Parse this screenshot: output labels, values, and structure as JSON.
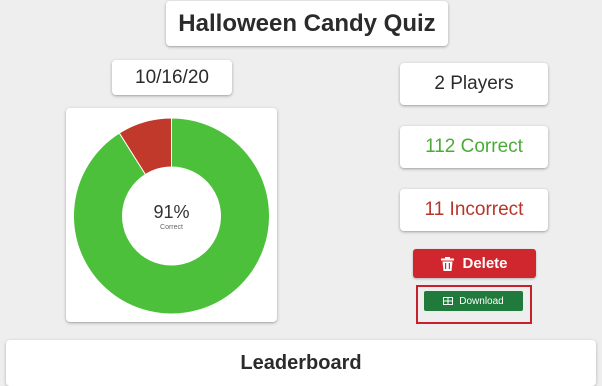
{
  "quiz": {
    "title": "Halloween Candy Quiz",
    "date": "10/16/20"
  },
  "stats": {
    "players": "2 Players",
    "correct": "112 Correct",
    "incorrect": "11 Incorrect"
  },
  "chart_data": {
    "type": "pie",
    "categories": [
      "Correct",
      "Incorrect"
    ],
    "values": [
      112,
      11
    ],
    "colors": [
      "#4cc03a",
      "#c0392b"
    ],
    "center_label": "91%",
    "center_sublabel": "Correct"
  },
  "actions": {
    "delete_label": "Delete",
    "download_label": "Download",
    "delete_icon": "trash-icon",
    "download_icon": "table-icon",
    "delete_color": "#d0262d",
    "download_color": "#1f7a3b"
  },
  "leaderboard": {
    "title": "Leaderboard"
  }
}
